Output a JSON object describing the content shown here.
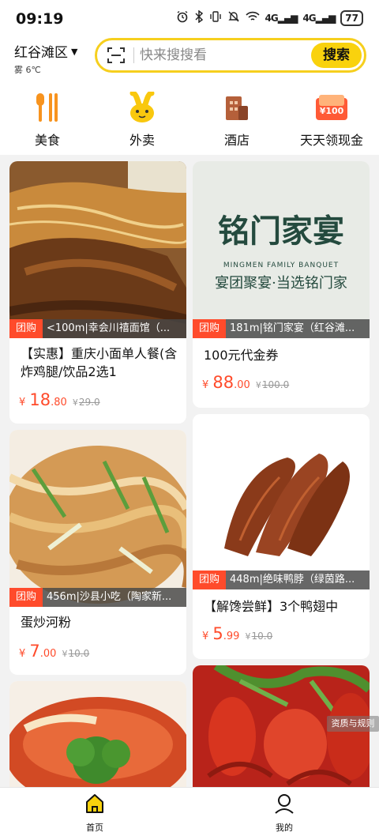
{
  "status_bar": {
    "time": "09:19",
    "battery": "77",
    "network_1": "4G",
    "network_2": "4G"
  },
  "header": {
    "location": "红谷滩区",
    "weather": "雾 6℃"
  },
  "search": {
    "placeholder": "快来搜搜看",
    "button_label": "搜索"
  },
  "categories": [
    {
      "label": "美食",
      "icon": "fork-knife-icon"
    },
    {
      "label": "外卖",
      "icon": "rabbit-mascot-icon"
    },
    {
      "label": "酒店",
      "icon": "hotel-building-icon"
    },
    {
      "label": "天天领现金",
      "icon": "cash-envelope-icon",
      "badge": "¥100"
    }
  ],
  "feed": [
    {
      "tag": "团购",
      "shop": "<100m|幸会川禧面馆（...",
      "title": "【实惠】重庆小面单人餐(含炸鸡腿/饮品2选1",
      "price_yen": "¥",
      "price_int": "18",
      "price_dec": ".80",
      "orig_yen": "¥",
      "orig_price": "29.0"
    },
    {
      "tag": "团购",
      "shop": "181m|铭门家宴（红谷滩...",
      "title": "100元代金券",
      "image_text_main": "铭门家宴",
      "image_text_en": "MINGMEN FAMILY BANQUET",
      "image_text_slogan": "宴团聚宴·当选铭门家",
      "price_yen": "¥",
      "price_int": "88",
      "price_dec": ".00",
      "orig_yen": "¥",
      "orig_price": "100.0"
    },
    {
      "tag": "团购",
      "shop": "456m|沙县小吃（陶家新...",
      "title": "蛋炒河粉",
      "price_yen": "¥",
      "price_int": "7",
      "price_dec": ".00",
      "orig_yen": "¥",
      "orig_price": "10.0"
    },
    {
      "tag": "团购",
      "shop": "448m|绝味鸭脖（绿茵路...",
      "title": "【解馋尝鲜】3个鸭翅中",
      "price_yen": "¥",
      "price_int": "5",
      "price_dec": ".99",
      "orig_yen": "¥",
      "orig_price": "10.0"
    }
  ],
  "quality_label": "资质与规则",
  "nav": [
    {
      "label": "首页",
      "icon": "home-icon"
    },
    {
      "label": "我的",
      "icon": "user-icon"
    }
  ],
  "colors": {
    "accent_yellow": "#f9d20d",
    "price_red": "#ff4b2b",
    "background": "#f2f2f2"
  }
}
